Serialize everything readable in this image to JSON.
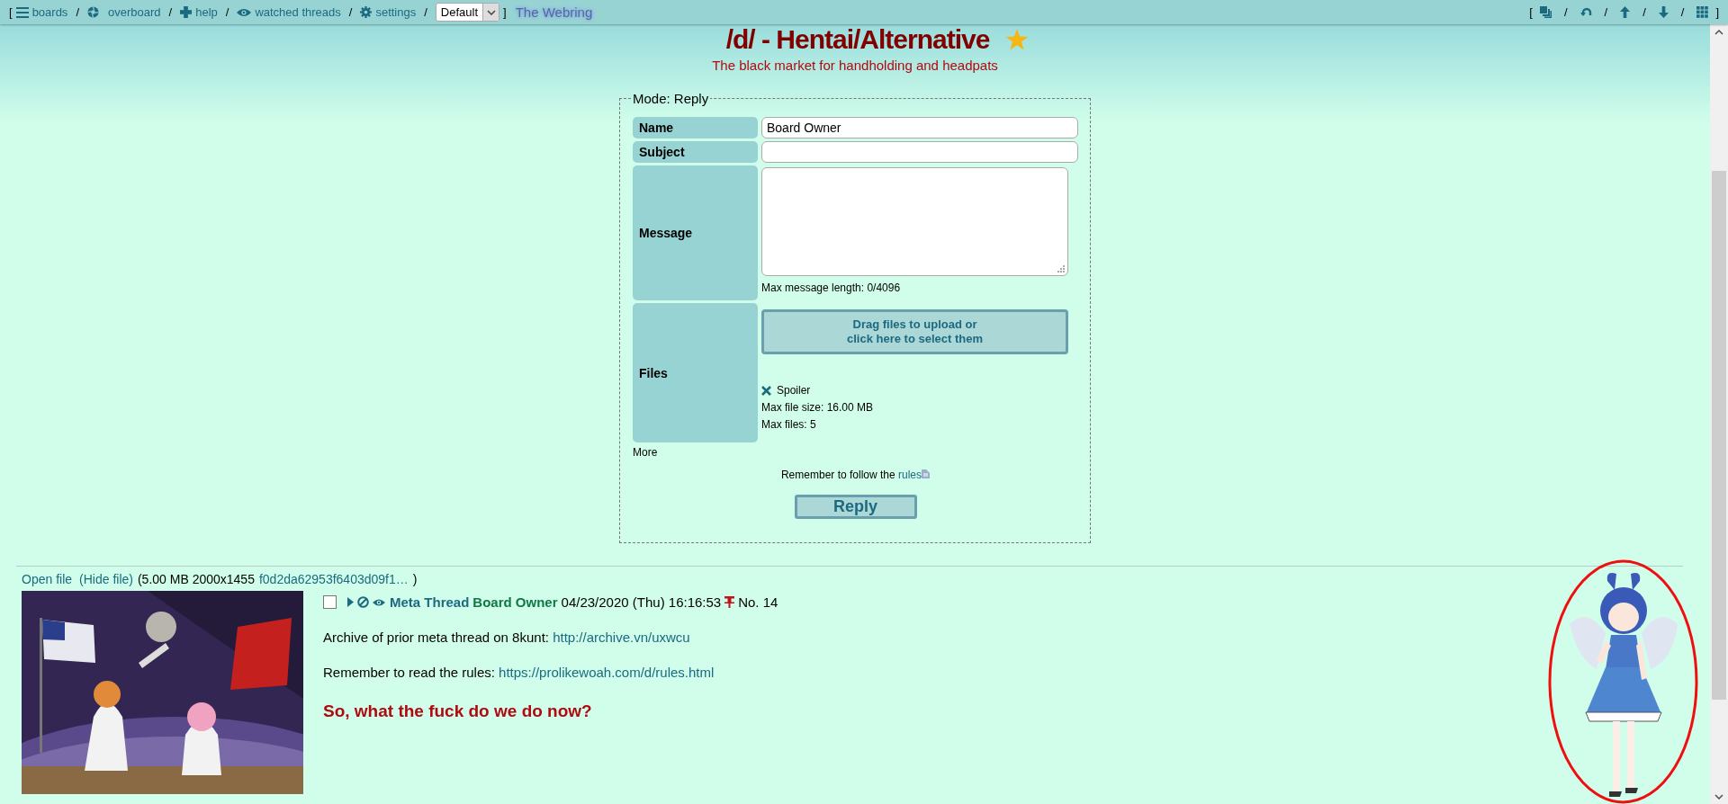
{
  "top_bar": {
    "left": [
      {
        "kind": "bracket",
        "label": "["
      },
      {
        "kind": "link",
        "label": "boards"
      },
      {
        "kind": "sep",
        "label": "/"
      },
      {
        "kind": "link",
        "label": "overboard"
      },
      {
        "kind": "sep",
        "label": "/"
      },
      {
        "kind": "link",
        "label": "help"
      },
      {
        "kind": "sep",
        "label": "/"
      },
      {
        "kind": "link",
        "label": "watched threads"
      },
      {
        "kind": "sep",
        "label": "/"
      },
      {
        "kind": "link",
        "label": "settings"
      },
      {
        "kind": "sep",
        "label": "/"
      },
      {
        "kind": "select",
        "value": "Default"
      },
      {
        "kind": "bracket",
        "label": "]"
      },
      {
        "kind": "webring",
        "label": "The Webring"
      }
    ],
    "right": [
      {
        "kind": "bracket",
        "label": "["
      },
      {
        "kind": "icon"
      },
      {
        "kind": "sep",
        "label": "/"
      },
      {
        "kind": "icon"
      },
      {
        "kind": "sep",
        "label": "/"
      },
      {
        "kind": "icon"
      },
      {
        "kind": "sep",
        "label": "/"
      },
      {
        "kind": "icon"
      },
      {
        "kind": "sep",
        "label": "/"
      },
      {
        "kind": "icon"
      },
      {
        "kind": "bracket",
        "label": "]"
      }
    ]
  },
  "board": {
    "title": "/d/ - Hentai/Alternative",
    "favorite": true,
    "subtitle": "The black market for handholding and headpats"
  },
  "reply_form": {
    "legend": "Mode: Reply",
    "fields": [
      {
        "kind": "text",
        "label": "Name",
        "value": "Board Owner"
      },
      {
        "kind": "text",
        "label": "Subject"
      },
      {
        "kind": "textarea",
        "label": "Message",
        "note": "Max message length: 0/4096"
      },
      {
        "kind": "files",
        "label": "Files",
        "dropzone": [
          "Drag files to upload or",
          "click here to select them"
        ],
        "spoiler": "Spoiler",
        "notes": [
          "Max file size: 16.00 MB",
          "Max files: 5"
        ]
      }
    ],
    "more": "More",
    "rules_text": "Remember to follow the",
    "rules_link": "rules",
    "submit": "Reply"
  },
  "post": {
    "file_links": [
      "Open file",
      "(Hide file)"
    ],
    "file_info": "(5.00 MB 2000x1455",
    "file_name": "f0d2da62953f6403d09f1…",
    "file_info_end": ")",
    "thumbnail": {
      "kind": "picture"
    },
    "checked": false,
    "subject": "Meta Thread",
    "name": "Board Owner",
    "date": "04/23/2020 (Thu) 16:16:53",
    "pinned": true,
    "number": "No. 14",
    "body": [
      {
        "kind": "text",
        "text": "Archive of prior meta thread on 8kunt:",
        "link": "http://archive.vn/uxwcu"
      },
      {
        "kind": "text",
        "text": "Remember to read the rules:",
        "link": "https://prolikewoah.com/d/rules.html"
      },
      {
        "kind": "heading",
        "text": "So, what the fuck do we do now?"
      }
    ]
  },
  "side_picture": {
    "kind": "picture",
    "circled": true
  }
}
